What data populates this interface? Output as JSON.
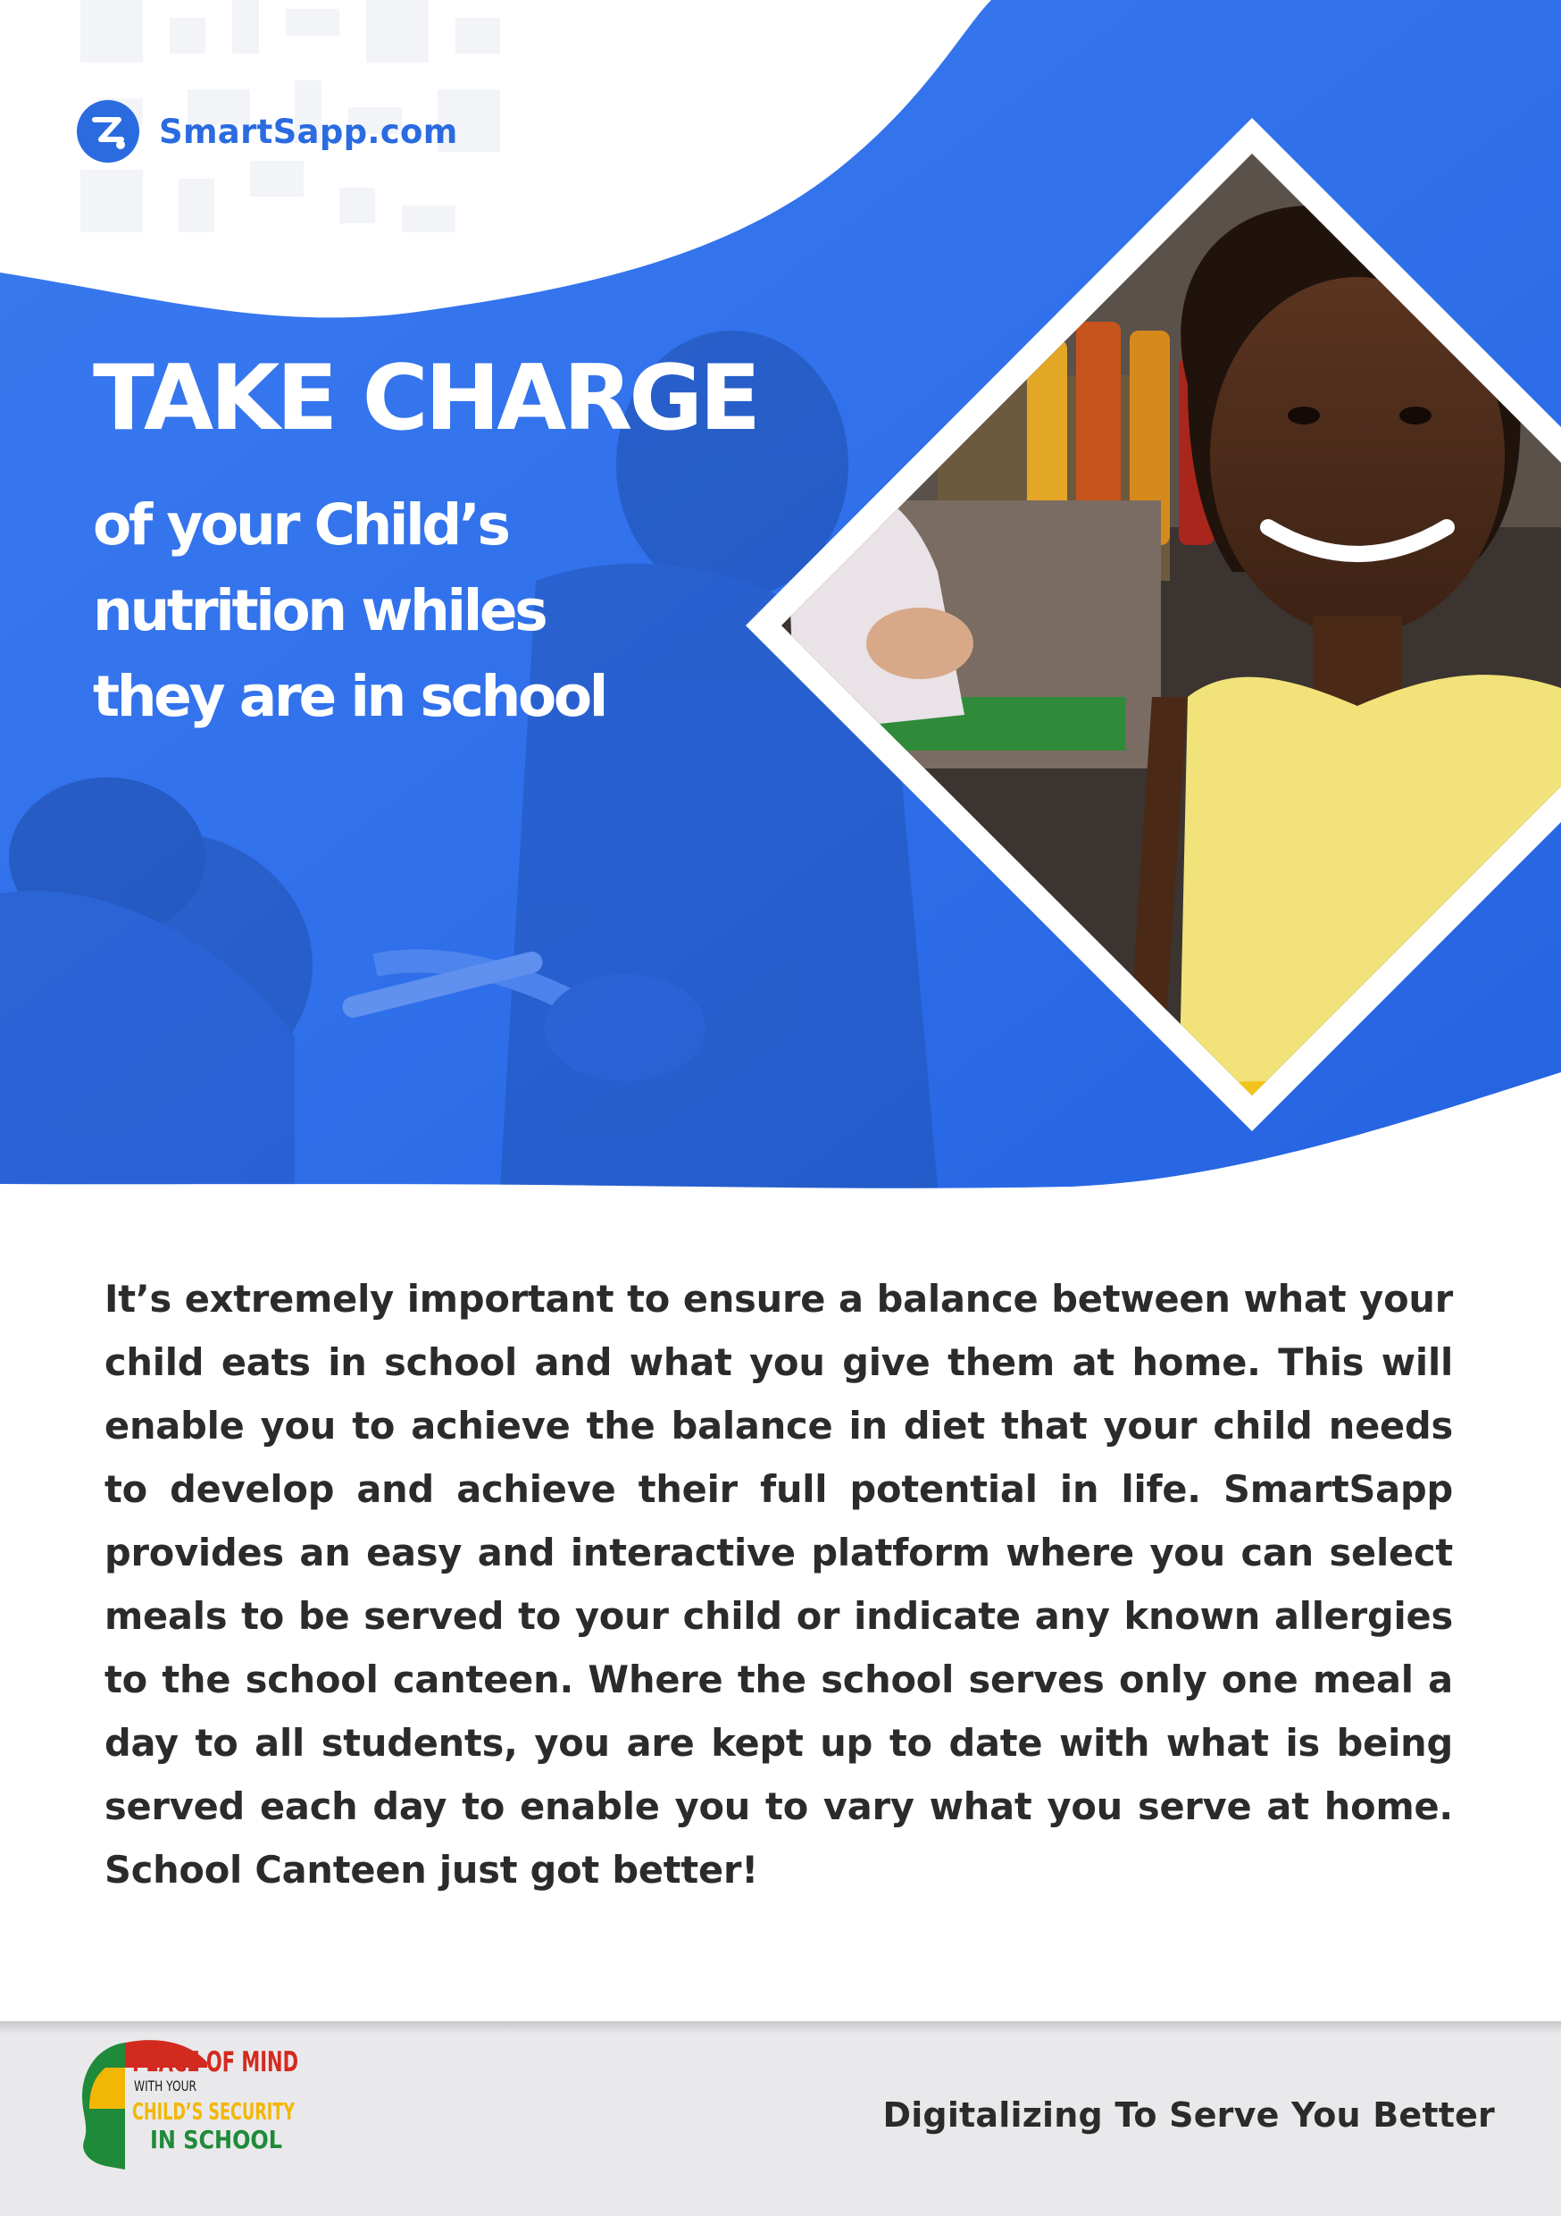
{
  "brand": {
    "name": "SmartSapp.com",
    "color": "#2a6be0"
  },
  "hero": {
    "headline": "TAKE CHARGE",
    "subheadline_lines": [
      "of your Child’s",
      "nutrition whiles",
      "they are in school"
    ],
    "background_color": "#2f6fea"
  },
  "body": {
    "paragraph": "It’s extremely important to ensure a balance between what your child eats in school and what you give them at home. This will enable you to achieve the balance in diet that your child needs to develop and achieve their full potential in life. SmartSapp provides an easy and interactive platform where you can select meals to be served to your child or indicate any known allergies to the school canteen. Where the school serves only one meal a day to all students, you are kept up to date with what is being served each day to enable you to vary what you serve at home. School Canteen just got better!"
  },
  "footer": {
    "badge": {
      "line1": "PEACE OF MIND",
      "line2": "WITH YOUR",
      "line3": "CHILD’S SECURITY",
      "line4": "IN SCHOOL"
    },
    "tagline": "Digitalizing To Serve You Better"
  },
  "icons": [
    "smartsapp-logo-icon",
    "peace-of-mind-badge"
  ],
  "colors": {
    "primary_blue": "#2f6fea",
    "text_dark": "#2b2b2b",
    "footer_bg": "#e9e9eb",
    "badge_red": "#d32a1f",
    "badge_yellow": "#f2b705",
    "badge_green": "#1f8a3a"
  }
}
